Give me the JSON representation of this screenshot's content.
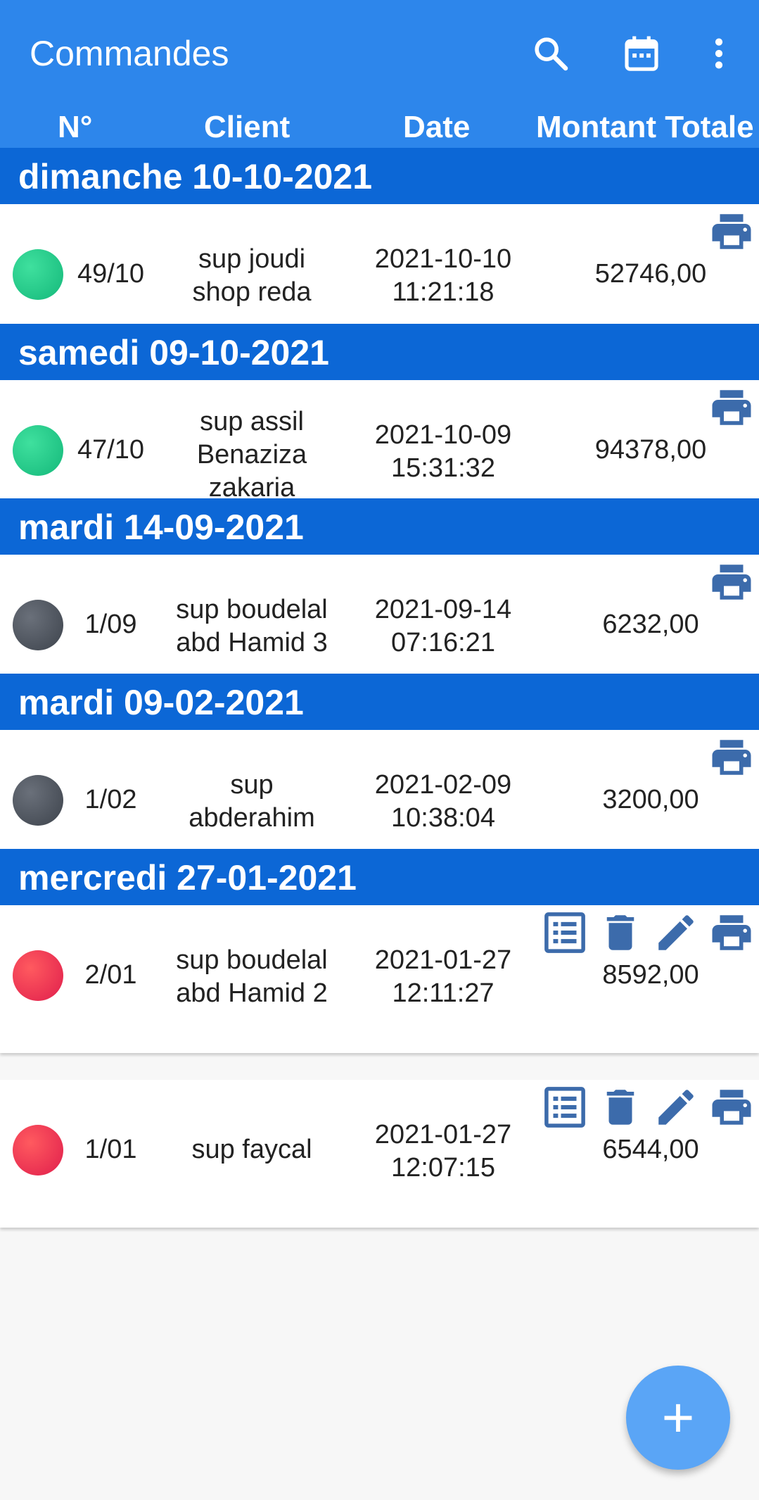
{
  "appbar": {
    "title": "Commandes",
    "actions": [
      "search-icon",
      "calendar-icon",
      "more-vert-icon"
    ],
    "color": "#2d86eb"
  },
  "columns": {
    "num": "N°",
    "client": "Client",
    "date": "Date",
    "amount": "Montant Totale"
  },
  "sections": [
    {
      "label": "dimanche 10-10-2021"
    },
    {
      "label": "samedi 09-10-2021"
    },
    {
      "label": "mardi 14-09-2021"
    },
    {
      "label": "mardi 09-02-2021"
    },
    {
      "label": "mercredi 27-01-2021"
    }
  ],
  "orders": [
    {
      "status": "green",
      "num": "49/10",
      "client": "sup joudi\nshop reda",
      "date": "2021-10-10\n11:21:18",
      "amount": "52746,00",
      "actions": [
        "print-icon"
      ]
    },
    {
      "status": "green",
      "num": "47/10",
      "client": "sup assil\nBenaziza\nzakaria",
      "date": "2021-10-09\n15:31:32",
      "amount": "94378,00",
      "actions": [
        "print-icon"
      ]
    },
    {
      "status": "gray",
      "num": "1/09",
      "client": "sup boudelal\nabd Hamid 3",
      "date": "2021-09-14\n07:16:21",
      "amount": "6232,00",
      "actions": [
        "print-icon"
      ]
    },
    {
      "status": "gray",
      "num": "1/02",
      "client": "sup\nabderahim",
      "date": "2021-02-09\n10:38:04",
      "amount": "3200,00",
      "actions": [
        "print-icon"
      ]
    },
    {
      "status": "red",
      "num": "2/01",
      "client": "sup boudelal\nabd Hamid 2",
      "date": "2021-01-27\n12:11:27",
      "amount": "8592,00",
      "actions": [
        "list-icon",
        "delete-icon",
        "edit-icon",
        "print-icon"
      ]
    },
    {
      "status": "red",
      "num": "1/01",
      "client": "sup faycal",
      "date": "2021-01-27\n12:07:15",
      "amount": "6544,00",
      "actions": [
        "list-icon",
        "delete-icon",
        "edit-icon",
        "print-icon"
      ]
    }
  ],
  "fab": {
    "label": "+",
    "icon": "add-icon"
  },
  "colors": {
    "section": "#0c67d6",
    "icon": "#3c6bab",
    "status_green": "#1fc585",
    "status_gray": "#4b525c",
    "status_red": "#ec3050"
  }
}
